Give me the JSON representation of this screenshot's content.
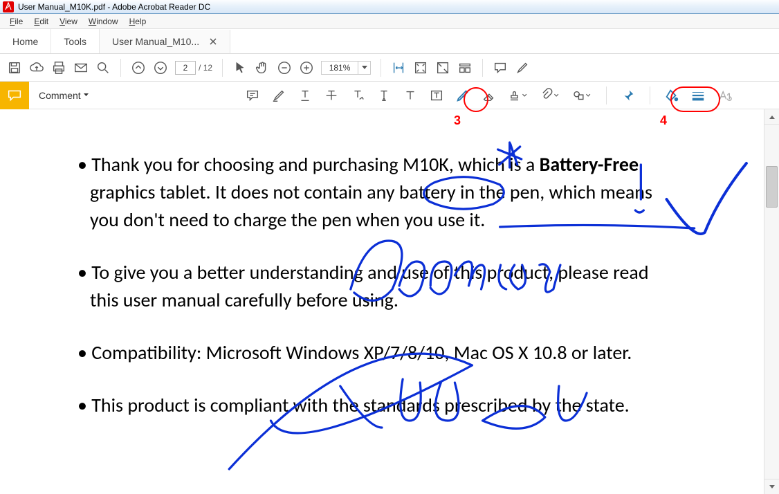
{
  "titlebar": {
    "title": "User Manual_M10K.pdf - Adobe Acrobat Reader DC"
  },
  "menu": {
    "file": "File",
    "edit": "Edit",
    "view": "View",
    "window": "Window",
    "help": "Help"
  },
  "tabs": {
    "home": "Home",
    "tools": "Tools",
    "doc": "User Manual_M10..."
  },
  "toolbar": {
    "page_current": "2",
    "page_sep": "/",
    "page_total": "12",
    "zoom": "181%"
  },
  "comment": {
    "label": "Comment"
  },
  "annotations": {
    "ring3_label": "3",
    "ring4_label": "4"
  },
  "document": {
    "p1_a": "• Thank you for choosing and purchasing M10K, which is a ",
    "p1_b": "Battery-Free",
    "p1_c": " graphics tablet. It does not contain any battery in the pen, which means you don't need to charge the pen when you use it.",
    "p2": "• To give you a better understanding and use of this product, please read this user manual carefully before using.",
    "p3": "• Compatibility: Microsoft Windows XP/7/8/10, Mac OS X 10.8 or later.",
    "p4": "• This product is compliant with the standards prescribed by the state."
  }
}
